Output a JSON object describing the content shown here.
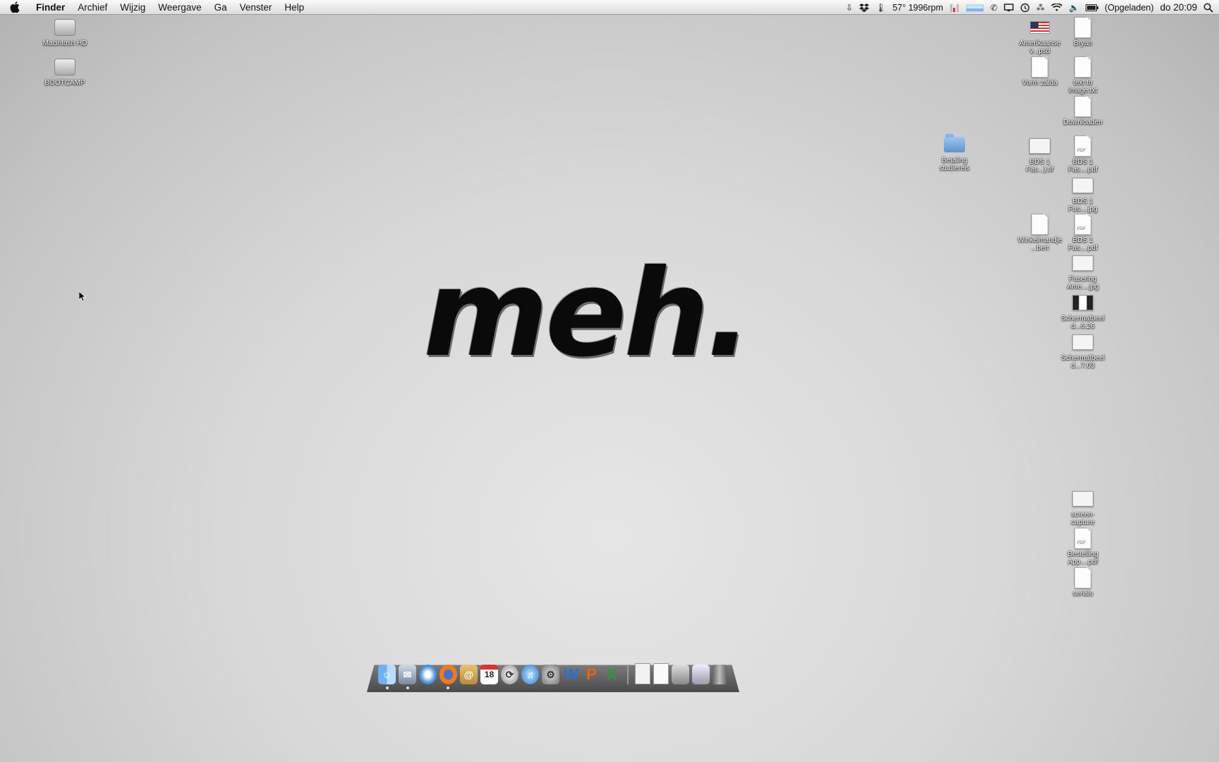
{
  "menubar": {
    "app_name": "Finder",
    "items": [
      "Archief",
      "Wijzig",
      "Weergave",
      "Ga",
      "Venster",
      "Help"
    ],
    "status": {
      "temp_fan": "57° 1996rpm",
      "battery": "(Opgeladen)",
      "clock": "do 20:09"
    }
  },
  "desktop_left": [
    {
      "label": "Macintosh HD",
      "icon": "hard-drive-icon"
    },
    {
      "label": "BOOTCAMP",
      "icon": "hard-drive-icon"
    }
  ],
  "desktop_right": [
    {
      "label": "Amerikaanse v...psd",
      "icon": "flag-icon"
    },
    {
      "label": "Bryan",
      "icon": "document-icon"
    },
    {
      "label": "Vorm zalda",
      "icon": "document-icon"
    },
    {
      "label": "text to image.txt",
      "icon": "text-file-icon"
    },
    {
      "label": "Downloaden",
      "icon": "document-icon"
    },
    {
      "label": "Betaling studiereis",
      "icon": "folder-icon"
    },
    {
      "label": "BDS 1 Fas...).tif",
      "icon": "image-file-icon"
    },
    {
      "label": "BDS 1 Fas....pdf",
      "icon": "pdf-file-icon"
    },
    {
      "label": "BDS 1 Fas....jpg",
      "icon": "image-file-icon"
    },
    {
      "label": "Winkelmandje...bert",
      "icon": "document-icon"
    },
    {
      "label": "BDS 1 Fas....pdf",
      "icon": "pdf-file-icon"
    },
    {
      "label": "Fasering Ame....jpg",
      "icon": "image-file-icon"
    },
    {
      "label": "Schermafbeeld...6.26",
      "icon": "screenshot-icon"
    },
    {
      "label": "Schermafbeeld...7.03",
      "icon": "screenshot-icon"
    },
    {
      "label": "screen-capture",
      "icon": "screenshot-icon"
    },
    {
      "label": "Bestelling App....pdf",
      "icon": "pdf-file-icon"
    },
    {
      "label": "serials",
      "icon": "document-icon"
    }
  ],
  "wallpaper_text": "meh.",
  "dock": {
    "apps": [
      "finder-icon",
      "mail-icon",
      "safari-icon",
      "firefox-icon",
      "address-book-icon",
      "calendar-icon",
      "sync-icon",
      "itunes-icon",
      "system-preferences-icon",
      "word-icon",
      "powerpoint-icon",
      "excel-icon"
    ],
    "calendar_day": "18",
    "others": [
      "document-stack-icon",
      "document-stack-icon",
      "folder-stack-icon",
      "downloads-stack-icon",
      "trash-icon"
    ]
  },
  "colors": {
    "word": "#2f6fd6",
    "powerpoint": "#e4641c",
    "excel": "#2a9a3a"
  }
}
